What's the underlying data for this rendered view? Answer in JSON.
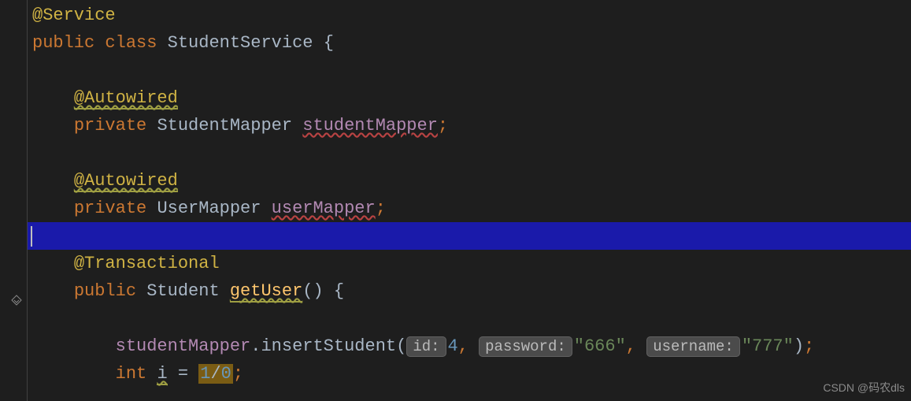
{
  "code": {
    "annotation_service": "@Service",
    "kw_public": "public",
    "kw_class": "class",
    "class_name": "StudentService",
    "brace_open": "{",
    "annotation_autowired": "@Autowired",
    "kw_private": "private",
    "type_student_mapper": "StudentMapper",
    "field_student_mapper": "studentMapper",
    "type_user_mapper": "UserMapper",
    "field_user_mapper": "userMapper",
    "annotation_transactional": "@Transactional",
    "type_student": "Student",
    "method_getuser": "getUser",
    "parens": "()",
    "method_insert": "insertStudent",
    "hint_id": "id:",
    "arg_id": "4",
    "hint_password": "password:",
    "arg_password": "\"666\"",
    "hint_username": "username:",
    "arg_username": "\"777\"",
    "kw_int": "int",
    "var_i": "i",
    "eq": "=",
    "val_one": "1",
    "val_slash": "/",
    "val_zero": "0",
    "semi": ";",
    "comma": ",",
    "dot": "."
  },
  "watermark": "CSDN @码农dls"
}
